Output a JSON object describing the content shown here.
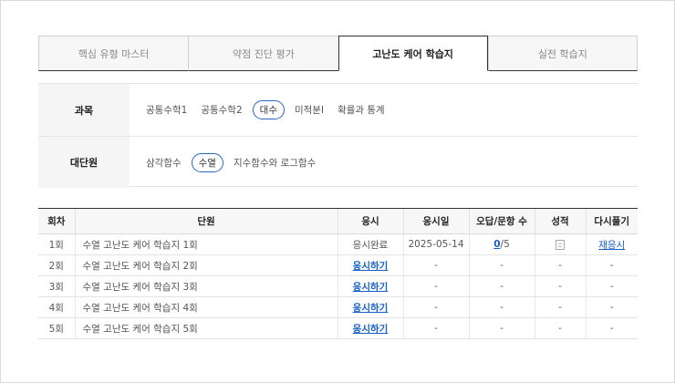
{
  "tabs": [
    {
      "label": "핵심 유형 마스터",
      "active": false
    },
    {
      "label": "약점 진단 평가",
      "active": false
    },
    {
      "label": "고난도 케어 학습지",
      "active": true
    },
    {
      "label": "실전 학습지",
      "active": false
    }
  ],
  "filters": {
    "subject": {
      "label": "과목",
      "options": [
        "공통수학1",
        "공통수학2",
        "대수",
        "미적분I",
        "확률과 통계"
      ],
      "selected": "대수"
    },
    "unit": {
      "label": "대단원",
      "options": [
        "삼각함수",
        "수열",
        "지수함수와 로그함수"
      ],
      "selected": "수열"
    }
  },
  "table": {
    "headers": [
      "회차",
      "단원",
      "응시",
      "응시일",
      "오답/문항 수",
      "성적",
      "다시풀기"
    ],
    "rows": [
      {
        "round": "1회",
        "unit": "수열 고난도 케어 학습지 1회",
        "take": "응시완료",
        "date": "2025-05-14",
        "wrong": "0",
        "total": "/5",
        "grade": "report-icon",
        "retry": "재응시"
      },
      {
        "round": "2회",
        "unit": "수열 고난도 케어 학습지 2회",
        "take": "응시하기",
        "date": "-",
        "wrong": "-",
        "total": "",
        "grade": "-",
        "retry": "-"
      },
      {
        "round": "3회",
        "unit": "수열 고난도 케어 학습지 3회",
        "take": "응시하기",
        "date": "-",
        "wrong": "-",
        "total": "",
        "grade": "-",
        "retry": "-"
      },
      {
        "round": "4회",
        "unit": "수열 고난도 케어 학습지 4회",
        "take": "응시하기",
        "date": "-",
        "wrong": "-",
        "total": "",
        "grade": "-",
        "retry": "-"
      },
      {
        "round": "5회",
        "unit": "수열 고난도 케어 학습지 5회",
        "take": "응시하기",
        "date": "-",
        "wrong": "-",
        "total": "",
        "grade": "-",
        "retry": "-"
      }
    ]
  },
  "colors": {
    "accent": "#1a5fc8",
    "selected_border": "#2a66c4"
  }
}
